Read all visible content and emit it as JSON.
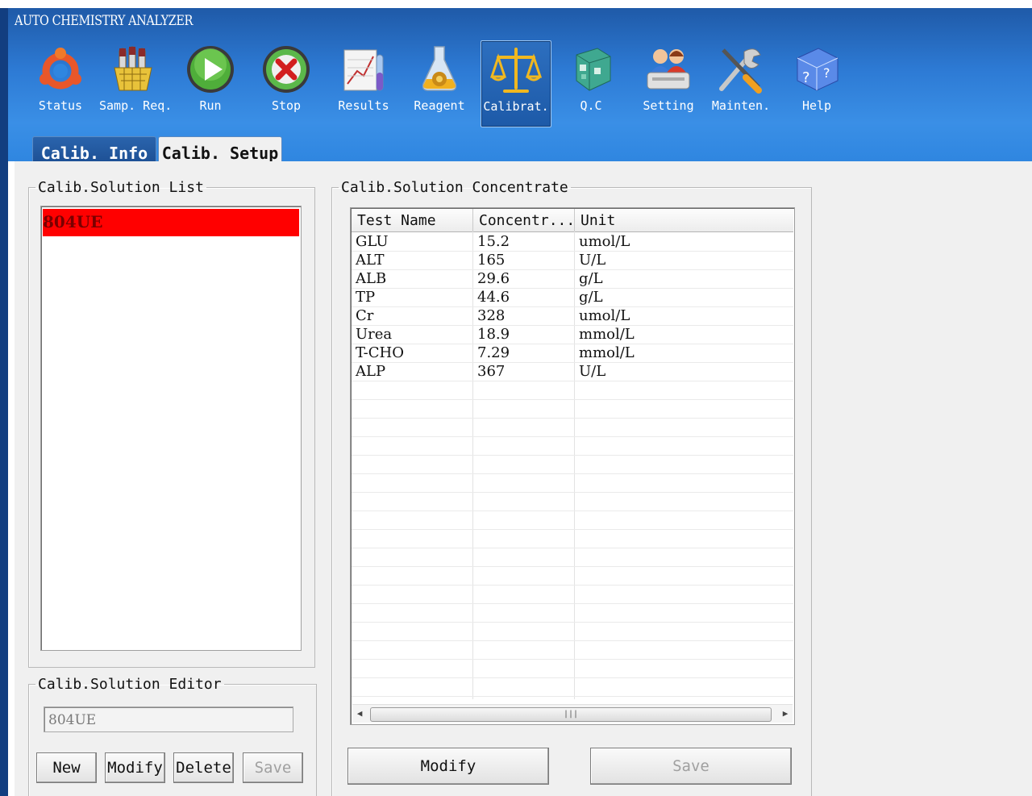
{
  "app": {
    "title": "AUTO CHEMISTRY ANALYZER"
  },
  "toolbar": {
    "items": [
      {
        "label": "Status",
        "icon": "ubuntu-status-icon"
      },
      {
        "label": "Samp. Req.",
        "icon": "test-tubes-icon"
      },
      {
        "label": "Run",
        "icon": "play-icon"
      },
      {
        "label": "Stop",
        "icon": "stop-icon"
      },
      {
        "label": "Results",
        "icon": "results-chart-icon"
      },
      {
        "label": "Reagent",
        "icon": "reagent-flask-icon"
      },
      {
        "label": "Calibrat.",
        "icon": "balance-scale-icon"
      },
      {
        "label": "Q.C",
        "icon": "qc-cube-icon"
      },
      {
        "label": "Setting",
        "icon": "users-setting-icon"
      },
      {
        "label": "Mainten.",
        "icon": "tools-icon"
      },
      {
        "label": "Help",
        "icon": "help-cube-icon"
      }
    ],
    "active": "Calibrat."
  },
  "tabs": {
    "calib_info": "Calib. Info",
    "calib_setup": "Calib. Setup"
  },
  "solution_list": {
    "title": "Calib.Solution List",
    "items": [
      "804UE"
    ],
    "selected": "804UE",
    "selected_color": "#ff0000"
  },
  "editor": {
    "title": "Calib.Solution Editor",
    "value": "804UE",
    "buttons": {
      "new": "New",
      "modify": "Modify",
      "delete": "Delete",
      "save": "Save"
    }
  },
  "concentrate": {
    "title": "Calib.Solution Concentrate",
    "columns": [
      "Test Name",
      "Concentr...",
      "Unit"
    ],
    "rows": [
      [
        "GLU",
        "15.2",
        "umol/L"
      ],
      [
        "ALT",
        "165",
        "U/L"
      ],
      [
        "ALB",
        "29.6",
        "g/L"
      ],
      [
        "TP",
        "44.6",
        "g/L"
      ],
      [
        "Cr",
        "328",
        "umol/L"
      ],
      [
        "Urea",
        "18.9",
        "mmol/L"
      ],
      [
        "T-CHO",
        "7.29",
        "mmol/L"
      ],
      [
        "ALP",
        "367",
        "U/L"
      ]
    ],
    "buttons": {
      "modify": "Modify",
      "save": "Save"
    }
  }
}
